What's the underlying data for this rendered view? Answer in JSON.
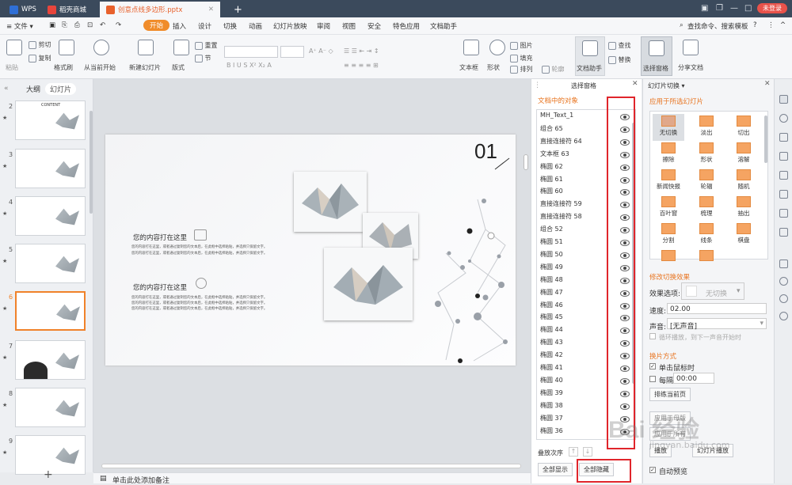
{
  "titlebar": {
    "wps_tab": "WPS",
    "store_tab": "稻壳商城",
    "doc_tab": "创意点线多边形.pptx",
    "new_tab": "+",
    "login": "未登录"
  },
  "menubar": {
    "file": "≡ 文件 ▾",
    "items": [
      "开始",
      "插入",
      "设计",
      "切换",
      "动画",
      "幻灯片放映",
      "审阅",
      "视图",
      "安全",
      "特色应用",
      "文档助手"
    ],
    "search": "查找命令、搜索模板",
    "help": "?"
  },
  "ribbon": {
    "paste": "粘贴",
    "cut": "剪切",
    "copy": "复制",
    "format_painter": "格式刷",
    "from_current": "从当前开始",
    "new_slide": "新建幻灯片",
    "layout": "版式",
    "reset": "重置",
    "section": "节",
    "text_box": "文本框",
    "shape": "形状",
    "picture": "图片",
    "fill": "填充",
    "arrange": "排列",
    "outline": "轮廓",
    "doc_assistant": "文档助手",
    "find": "查找",
    "replace": "替换",
    "selection_pane": "选择窗格",
    "share": "分享文档"
  },
  "leftpanel": {
    "outline_tab": "大纲",
    "slides_tab": "幻灯片",
    "slide_numbers": [
      "2",
      "3",
      "4",
      "5",
      "6",
      "7",
      "8",
      "9"
    ],
    "add": "+"
  },
  "slide": {
    "number": "01",
    "heading1": "您的内容打在这里",
    "body1a": "您的内容打在这里，或者通过复制您的文本后，在此框中选择粘贴，并选择只保留文字。",
    "body1b": "您的内容打在这里，或者通过复制您的文本后，在此框中选择粘贴，并选择只保留文字。",
    "heading2": "您的内容打在这里",
    "body2a": "您的内容打在这里，或者通过复制您的文本后，在此框中选择粘贴，并选择只保留文字。",
    "body2b": "您的内容打在这里，或者通过复制您的文本后，在此框中选择粘贴，并选择只保留文字。",
    "body2c": "您的内容打在这里，或者通过复制您的文本后，在此框中选择粘贴，并选择只保留文字。",
    "thumb_text": "CONTENT"
  },
  "statusbar": {
    "notes": "单击此处添加备注"
  },
  "selpane": {
    "title": "选择窗格",
    "section": "文档中的对象",
    "objects": [
      "MH_Text_1",
      "组合 65",
      "直接连接符 64",
      "文本框 63",
      "椭圆 62",
      "椭圆 61",
      "椭圆 60",
      "直接连接符 59",
      "直接连接符 58",
      "组合 52",
      "椭圆 51",
      "椭圆 50",
      "椭圆 49",
      "椭圆 48",
      "椭圆 47",
      "椭圆 46",
      "椭圆 45",
      "椭圆 44",
      "椭圆 43",
      "椭圆 42",
      "椭圆 41",
      "椭圆 40",
      "椭圆 39",
      "椭圆 38",
      "椭圆 37",
      "椭圆 36"
    ],
    "order_label": "叠放次序",
    "show_all": "全部显示",
    "hide_all": "全部隐藏"
  },
  "transpane": {
    "title": "幻灯片切换 ▾",
    "apply_section": "应用于所选幻灯片",
    "transitions": [
      "无切换",
      "淡出",
      "切出",
      "擦除",
      "形状",
      "溶解",
      "新闻快报",
      "轮辐",
      "随机",
      "百叶窗",
      "梳理",
      "抽出",
      "分割",
      "线条",
      "棋盘",
      "",
      ""
    ],
    "modify_section": "修改切换效果",
    "effect_label": "效果选项:",
    "effect_value": "无切换",
    "speed_label": "速度:",
    "speed_value": "02.00",
    "sound_label": "声音:",
    "sound_value": "[无声音]",
    "loop_label": "循环播放，到下一声音开始时",
    "advance_section": "换片方式",
    "on_click": "单击鼠标时",
    "every": "每隔",
    "every_value": "00:00",
    "sort_label": "排练当前页",
    "apply_all": "应用于母版",
    "apply_all_slides": "应用于所有",
    "play": "播放",
    "slideshow": "幻灯片播放",
    "auto_preview": "自动预览"
  },
  "watermark": {
    "brand": "Bai 经验",
    "url": "jingyan.baidu.com"
  }
}
